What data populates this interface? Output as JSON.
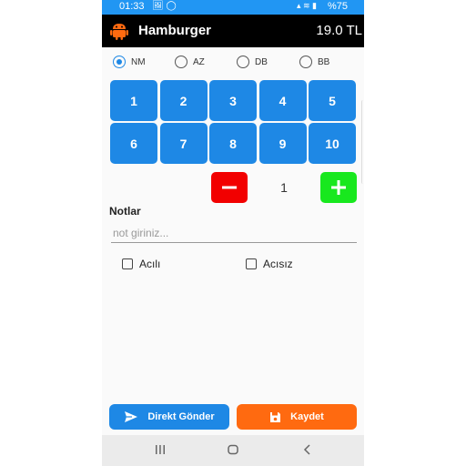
{
  "status_bar": {
    "time": "01:33",
    "battery": "%75"
  },
  "toolbar": {
    "title": "Hamburger",
    "price": "19.0 TL"
  },
  "sizes": [
    {
      "label": "NM",
      "selected": true
    },
    {
      "label": "AZ",
      "selected": false
    },
    {
      "label": "DB",
      "selected": false
    },
    {
      "label": "BB",
      "selected": false
    }
  ],
  "numpad": [
    "1",
    "2",
    "3",
    "4",
    "5",
    "6",
    "7",
    "8",
    "9",
    "10"
  ],
  "quantity": {
    "value": "1"
  },
  "notes": {
    "label": "Notlar",
    "placeholder": "not giriniz...",
    "value": ""
  },
  "options": [
    {
      "label": "Acılı",
      "checked": false
    },
    {
      "label": "Acısız",
      "checked": false
    }
  ],
  "actions": {
    "send_label": "Direkt Gönder",
    "save_label": "Kaydet"
  },
  "colors": {
    "primary": "#1e88e5",
    "minus": "#f20000",
    "plus": "#18e81e",
    "save": "#ff6a10",
    "status_bar": "#2196f3",
    "toolbar": "#000000"
  }
}
